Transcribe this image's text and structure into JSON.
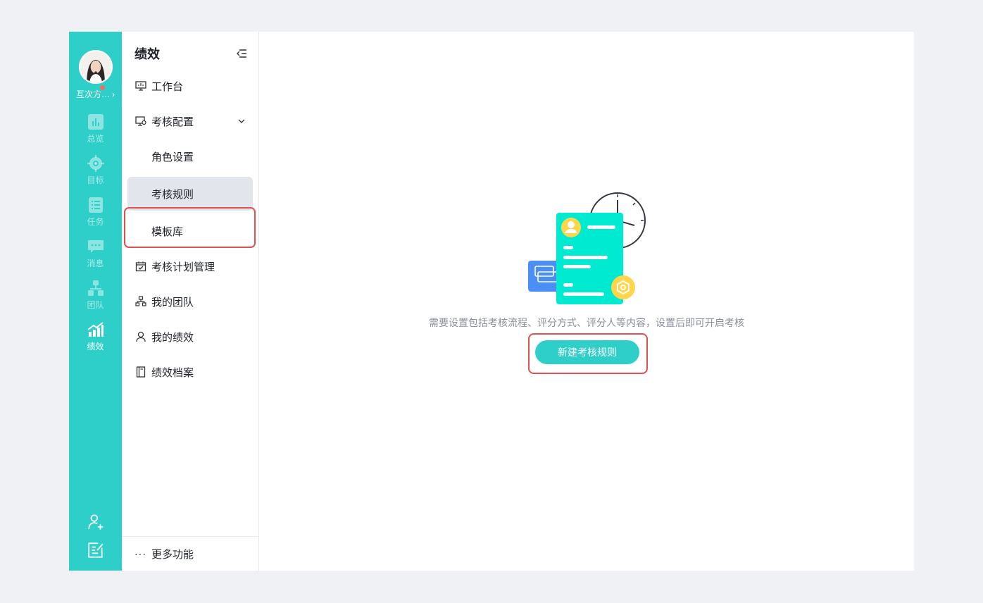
{
  "rail": {
    "user_name": "互次方…",
    "items": [
      {
        "label": "总览",
        "icon": "bar-chart-icon"
      },
      {
        "label": "目标",
        "icon": "target-icon"
      },
      {
        "label": "任务",
        "icon": "task-list-icon"
      },
      {
        "label": "消息",
        "icon": "message-icon"
      },
      {
        "label": "团队",
        "icon": "team-tree-icon"
      },
      {
        "label": "绩效",
        "icon": "performance-icon"
      }
    ],
    "bottom_icons": [
      "add-member-icon",
      "edit-note-icon"
    ]
  },
  "menu": {
    "title": "绩效",
    "items": [
      {
        "label": "工作台",
        "icon": "monitor-icon"
      },
      {
        "label": "考核配置",
        "icon": "config-screen-icon"
      },
      {
        "label": "角色设置"
      },
      {
        "label": "考核规则"
      },
      {
        "label": "模板库"
      },
      {
        "label": "考核计划管理",
        "icon": "calendar-check-icon"
      },
      {
        "label": "我的团队",
        "icon": "org-chart-icon"
      },
      {
        "label": "我的绩效",
        "icon": "person-icon"
      },
      {
        "label": "绩效档案",
        "icon": "archive-book-icon"
      }
    ],
    "more": "更多功能"
  },
  "main": {
    "empty_text": "需要设置包括考核流程、评分方式、评分人等内容，设置后即可开启考核",
    "new_button": "新建考核规则"
  },
  "colors": {
    "accent": "#2ecfc9",
    "highlight": "#e05050",
    "background": "#f0f1f5"
  }
}
